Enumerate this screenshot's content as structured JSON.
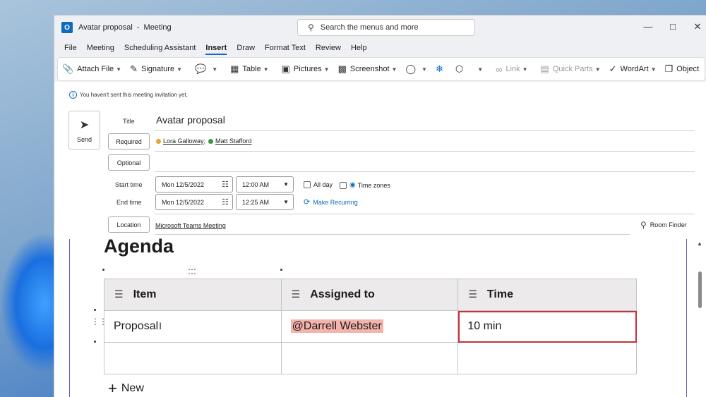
{
  "window": {
    "title": "Avatar proposal",
    "title_sep": "-",
    "type": "Meeting",
    "search_placeholder": "Search the menus and more"
  },
  "menu": [
    "File",
    "Meeting",
    "Scheduling Assistant",
    "Insert",
    "Draw",
    "Format Text",
    "Review",
    "Help"
  ],
  "ribbon": {
    "attach_file": "Attach File",
    "signature": "Signature",
    "table": "Table",
    "pictures": "Pictures",
    "screenshot": "Screenshot",
    "link": "Link",
    "quick_parts": "Quick Parts",
    "wordart": "WordArt",
    "object": "Object",
    "more": "···"
  },
  "form": {
    "notice": "You haven't sent this meeting invitation yet.",
    "send_label": "Send",
    "title_label": "Title",
    "title_value": "Avatar proposal",
    "required_label": "Required",
    "optional_label": "Optional",
    "attendees": [
      {
        "name": "Lora Galloway",
        "status_color": "#e8a33d",
        "sep": ";"
      },
      {
        "name": "Matt Stafford",
        "status_color": "#3a9b3a",
        "sep": ""
      }
    ],
    "start_time_label": "Start time",
    "end_time_label": "End time",
    "start_date": "Mon 12/5/2022",
    "start_time": "12:00 AM",
    "end_date": "Mon 12/5/2022",
    "end_time": "12:25 AM",
    "all_day": "All day",
    "time_zones": "Time zones",
    "make_recurring": "Make Recurring",
    "location_label": "Location",
    "location_value": "Microsoft Teams Meeting",
    "room_finder": "Room Finder"
  },
  "agenda": {
    "heading": "Agenda",
    "columns": [
      "Item",
      "Assigned to",
      "Time"
    ],
    "rows": [
      {
        "item": "Proposal",
        "assigned": "@Darrell Webster",
        "time": "10 min"
      },
      {
        "item": "",
        "assigned": "",
        "time": ""
      }
    ],
    "new_label": "New"
  },
  "colors": {
    "accent": "#0f6cbd",
    "mention_bg": "#f4b3ab",
    "selected_cell_border": "#c4313b"
  }
}
